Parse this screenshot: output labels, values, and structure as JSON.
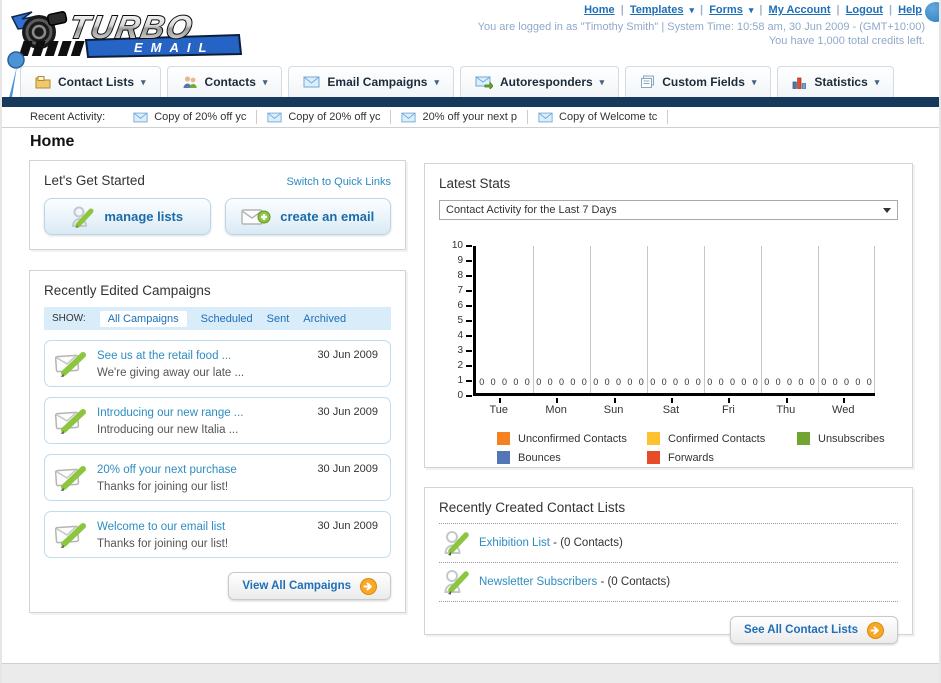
{
  "icons": {
    "chevron_down": "▾",
    "divider": "|"
  },
  "header": {
    "logo": {
      "title": "TURBO",
      "subtitle": "EMAIL"
    },
    "nav": [
      {
        "label": "Home",
        "dropdown": false
      },
      {
        "label": "Templates",
        "dropdown": true
      },
      {
        "label": "Forms",
        "dropdown": true
      },
      {
        "label": "My Account",
        "dropdown": false
      },
      {
        "label": "Logout",
        "dropdown": false
      },
      {
        "label": "Help",
        "dropdown": false
      }
    ],
    "login_info": "You are logged in as \"Timothy Smith\" | System Time: 10:58 am, 30 Jun 2009 - (GMT+10:00)",
    "credits_info": "You have 1,000 total credits left."
  },
  "nav_tabs": [
    {
      "label": "Contact Lists"
    },
    {
      "label": "Contacts"
    },
    {
      "label": "Email Campaigns"
    },
    {
      "label": "Autoresponders"
    },
    {
      "label": "Custom Fields"
    },
    {
      "label": "Statistics"
    }
  ],
  "recent_activity": {
    "label": "Recent Activity:",
    "items": [
      "Copy of 20% off yc",
      "Copy of 20% off yc",
      "20% off your next p",
      "Copy of Welcome tc"
    ]
  },
  "page_title": "Home",
  "get_started": {
    "title": "Let's Get Started",
    "switch_link": "Switch to Quick Links",
    "manage_lists_label": "manage lists",
    "create_email_label": "create an email"
  },
  "campaigns": {
    "title": "Recently Edited Campaigns",
    "show_label": "SHOW:",
    "filters": [
      "All Campaigns",
      "Scheduled",
      "Sent",
      "Archived"
    ],
    "active_filter": "All Campaigns",
    "items": [
      {
        "title": "See us at the retail food ...",
        "subtitle": "We're giving away our late ...",
        "date": "30 Jun 2009"
      },
      {
        "title": "Introducing our new range ...",
        "subtitle": "Introducing our new Italia ...",
        "date": "30 Jun 2009"
      },
      {
        "title": "20% off your next purchase",
        "subtitle": "Thanks for joining our list!",
        "date": "30 Jun 2009"
      },
      {
        "title": "Welcome to our email list",
        "subtitle": "Thanks for joining our list!",
        "date": "30 Jun 2009"
      }
    ],
    "view_all_label": "View All Campaigns"
  },
  "latest_stats": {
    "title": "Latest Stats",
    "selected_report": "Contact Activity for the Last 7 Days",
    "chart_data": {
      "type": "bar",
      "title": "Contact Activity for the Last 7 Days",
      "categories": [
        "Tue",
        "Mon",
        "Sun",
        "Sat",
        "Fri",
        "Thu",
        "Wed"
      ],
      "series": [
        {
          "name": "Unconfirmed Contacts",
          "color": "#F58220",
          "values": [
            0,
            0,
            0,
            0,
            0,
            0,
            0
          ]
        },
        {
          "name": "Confirmed Contacts",
          "color": "#FDC22D",
          "values": [
            0,
            0,
            0,
            0,
            0,
            0,
            0
          ]
        },
        {
          "name": "Unsubscribes",
          "color": "#71A430",
          "values": [
            0,
            0,
            0,
            0,
            0,
            0,
            0
          ]
        },
        {
          "name": "Bounces",
          "color": "#5377B6",
          "values": [
            0,
            0,
            0,
            0,
            0,
            0,
            0
          ]
        },
        {
          "name": "Forwards",
          "color": "#E74C28",
          "values": [
            0,
            0,
            0,
            0,
            0,
            0,
            0
          ]
        }
      ],
      "ylim": [
        0,
        10
      ],
      "ytick_step": 1,
      "grid": "vertical",
      "legend_position": "bottom",
      "value_labels_shown": true
    }
  },
  "contact_lists": {
    "title": "Recently Created Contact Lists",
    "items": [
      {
        "name": "Exhibition List",
        "count": "- (0 Contacts)"
      },
      {
        "name": "Newsletter Subscribers",
        "count": "- (0 Contacts)"
      }
    ],
    "see_all_label": "See All Contact Lists"
  },
  "colors": {
    "accent_blue": "#1D6FB8",
    "navy_bar": "#173A5C",
    "link_teal": "#2E8DC0",
    "button_orange": "#F9A825"
  }
}
